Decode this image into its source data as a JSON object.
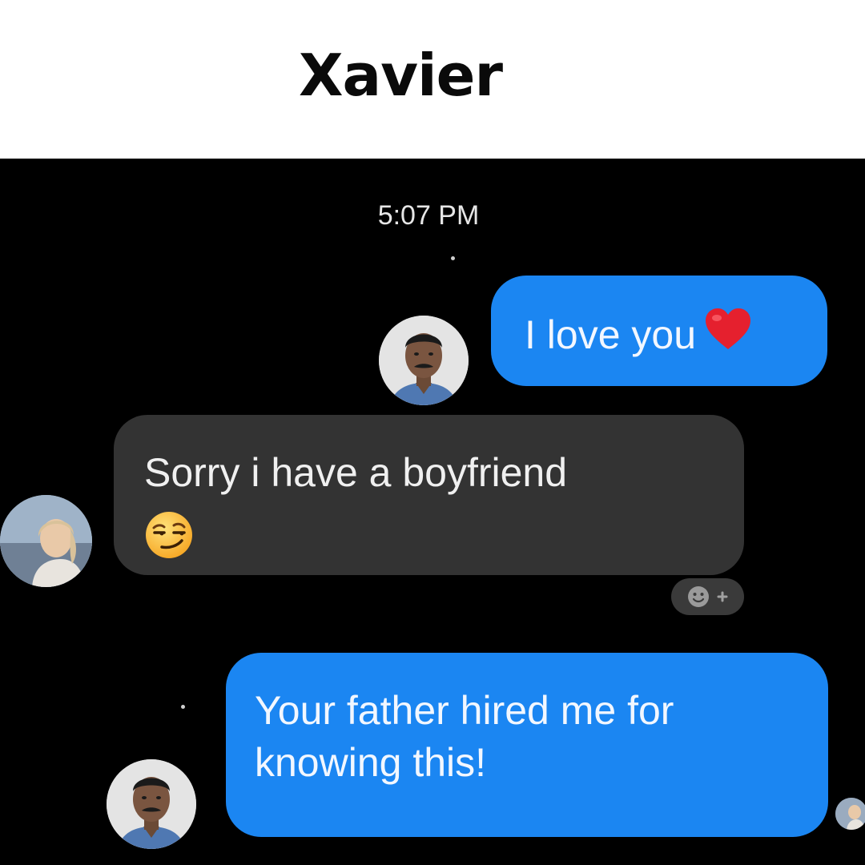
{
  "header": {
    "title": "Xavier"
  },
  "chat": {
    "timestamp": "5:07 PM",
    "messages": [
      {
        "direction": "sent",
        "lines": [
          "I love you"
        ],
        "emoji": "red-heart"
      },
      {
        "direction": "received",
        "lines": [
          "Sorry i have a boyfriend"
        ],
        "emoji": "smirking-face"
      },
      {
        "direction": "sent",
        "lines": [
          "Your father hired me for",
          "knowing this!"
        ]
      }
    ]
  },
  "colors": {
    "sent_bubble": "#1b86f2",
    "received_bubble": "#333333",
    "background": "#000000",
    "header_background": "#ffffff"
  },
  "icons": [
    "red-heart-icon",
    "smirking-face-icon",
    "add-reaction-icon",
    "avatar"
  ]
}
